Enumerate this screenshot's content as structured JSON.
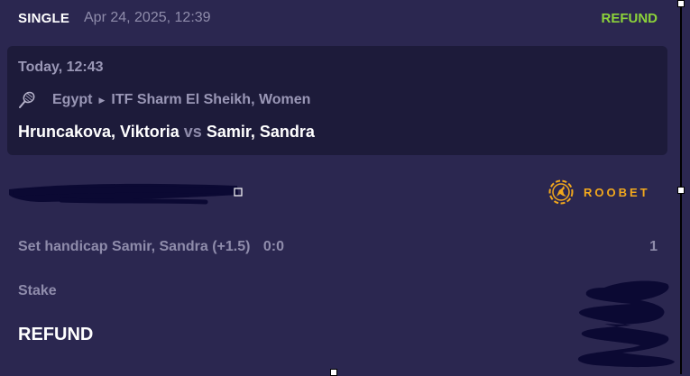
{
  "bet": {
    "type": "SINGLE",
    "placed_at": "Apr 24, 2025, 12:39",
    "status": "REFUND"
  },
  "event": {
    "time": "Today, 12:43",
    "sport_icon": "tennis-racket-icon",
    "country": "Egypt",
    "tournament": "ITF Sharm El Sheikh, Women",
    "home": "Hruncakova, Viktoria",
    "vs": "vs",
    "away": "Samir, Sandra"
  },
  "brand": {
    "name": "ROOBET",
    "icon": "kangaroo-logo-icon",
    "color": "#f2a81d"
  },
  "selection": {
    "market": "Set handicap Samir, Sandra (+1.5)",
    "score": "0:0",
    "odds": "1"
  },
  "stake": {
    "label": "Stake"
  },
  "result": {
    "label": "REFUND"
  },
  "colors": {
    "background": "#2b2750",
    "card": "#1d1b3a",
    "refund_green": "#8cd33a",
    "muted_text": "#8f8cab"
  }
}
